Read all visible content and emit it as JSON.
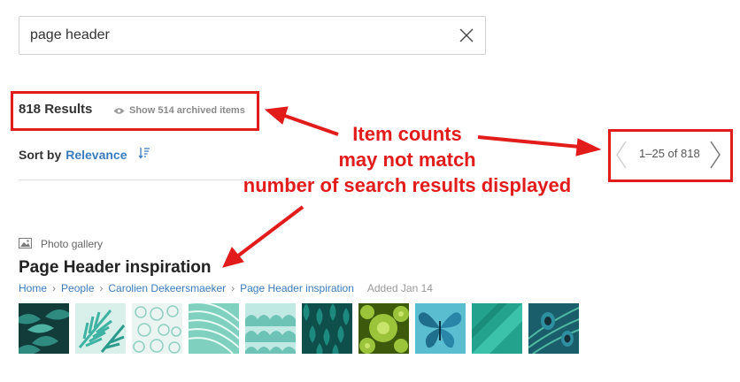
{
  "search": {
    "value": "page header"
  },
  "results": {
    "count_label": "818 Results",
    "archived_label": "Show 514 archived items"
  },
  "sort": {
    "label": "Sort by",
    "value": "Relevance"
  },
  "pager": {
    "range_label": "1–25 of 818"
  },
  "result": {
    "type_label": "Photo gallery",
    "title": "Page Header inspiration",
    "breadcrumb": [
      "Home",
      "People",
      "Carolien Dekeersmaeker",
      "Page Header inspiration"
    ],
    "added": "Added Jan 14",
    "thumbnail_colors": [
      "#1f5e5a",
      "#3eb3a3",
      "#cfe7df",
      "#3fb59c",
      "#8fd3c8",
      "#1b7d76",
      "#8cb42a",
      "#3ea3b8",
      "#2aa592",
      "#1c6f7a"
    ]
  },
  "annotation": {
    "line1": "Item counts",
    "line2": "may not match",
    "line3": "number of search results displayed"
  },
  "colors": {
    "accent": "#3a7bbd",
    "annotation": "#e21b1b"
  }
}
